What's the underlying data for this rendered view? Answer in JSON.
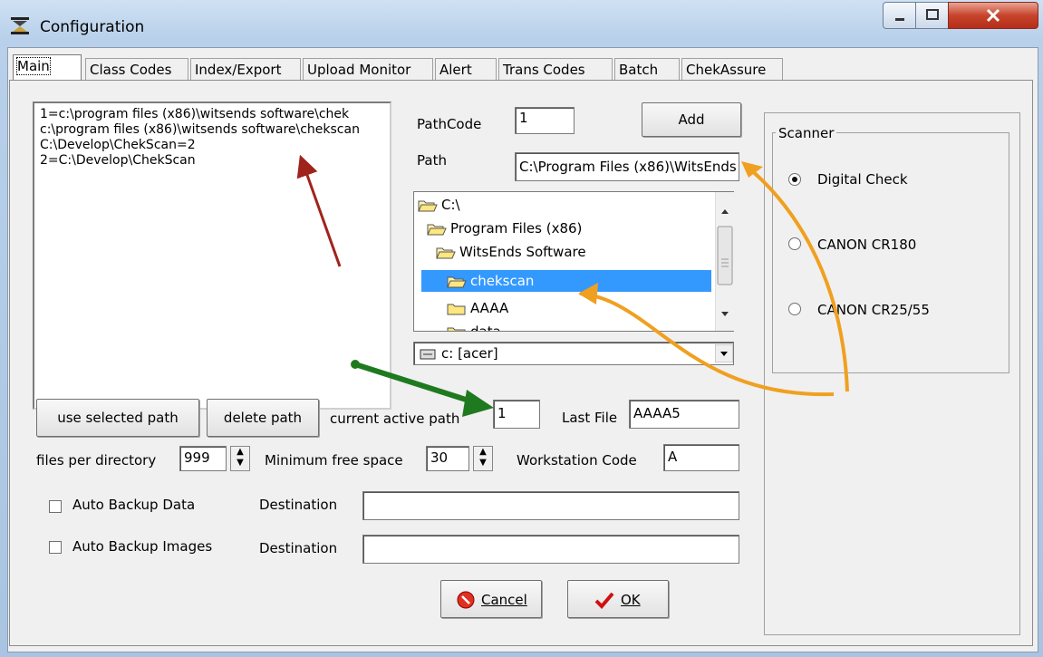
{
  "window": {
    "title": "Configuration"
  },
  "tabs": [
    "Main",
    "Class Codes",
    "Index/Export",
    "Upload Monitor",
    "Alert",
    "Trans Codes",
    "Batch",
    "ChekAssure"
  ],
  "path_list": [
    "1=c:\\program files (x86)\\witsends software\\chek",
    "c:\\program files (x86)\\witsends software\\chekscan",
    "C:\\Develop\\ChekScan=2",
    "2=C:\\Develop\\ChekScan"
  ],
  "pathcode": {
    "label": "PathCode",
    "value": "1"
  },
  "add_button": "Add",
  "path": {
    "label": "Path",
    "value": "C:\\Program Files (x86)\\WitsEnds"
  },
  "tree": [
    {
      "label": "C:\\"
    },
    {
      "label": "Program Files (x86)"
    },
    {
      "label": "WitsEnds Software"
    },
    {
      "label": "chekscan"
    },
    {
      "label": "AAAA"
    },
    {
      "label": "data"
    }
  ],
  "drive": {
    "value": "c: [acer]"
  },
  "buttons": {
    "use_selected_path": "use selected path",
    "delete_path": "delete path",
    "cancel": "Cancel",
    "ok": "OK"
  },
  "current_active_path": {
    "label": "current active path",
    "value": "1"
  },
  "last_file": {
    "label": "Last File",
    "value": "AAAA5"
  },
  "files_per_directory": {
    "label": "files per directory",
    "value": "999"
  },
  "minimum_free_space": {
    "label": "Minimum free space",
    "value": "30"
  },
  "workstation_code": {
    "label": "Workstation Code",
    "value": "A"
  },
  "auto_backup_data": {
    "label": "Auto Backup Data",
    "checked": false
  },
  "auto_backup_images": {
    "label": "Auto Backup Images",
    "checked": false
  },
  "destination_label": "Destination",
  "scanner": {
    "title": "Scanner",
    "options": [
      "Digital Check",
      "CANON CR180",
      "CANON CR25/55"
    ],
    "selected": "Digital Check"
  },
  "colors": {
    "selection": "#3399ff",
    "arrow_red": "#a0231b",
    "arrow_green": "#1f7a1f",
    "arrow_orange": "#f0a020"
  }
}
